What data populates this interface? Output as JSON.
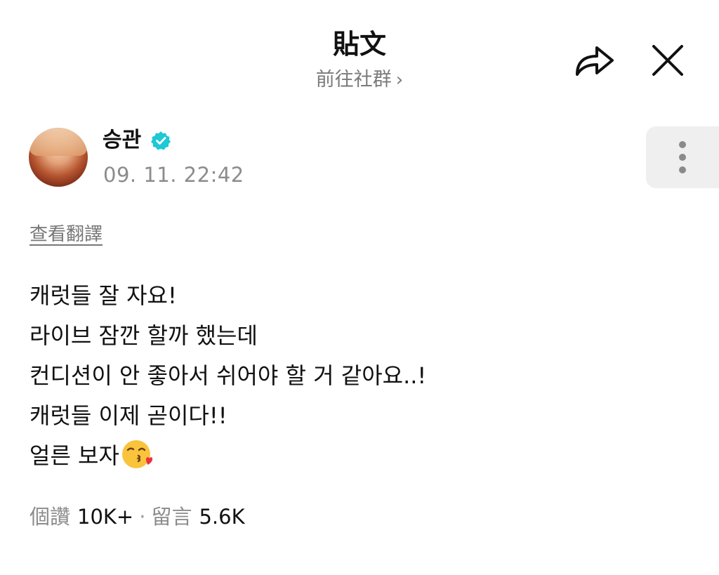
{
  "header": {
    "title": "貼文",
    "subtitle": "前往社群",
    "subtitle_chevron": "›"
  },
  "actions": {
    "share_icon": "share-arrow-icon",
    "close_icon": "close-icon",
    "more_icon": "more-vertical-icon"
  },
  "post": {
    "author": "승관",
    "verified": true,
    "verified_color": "#1ec8d6",
    "time": "09. 11. 22:42",
    "translate_label": "查看翻譯",
    "lines": [
      "캐럿들 잘 자요!",
      "라이브 잠깐 할까 했는데",
      "컨디션이 안 좋아서 쉬어야 할 거 같아요..!",
      "캐럿들 이제 곧이다!!",
      "얼른 보자"
    ],
    "trailing_emoji": "face-blowing-kiss"
  },
  "stats": {
    "likes_label": "個讚",
    "likes_value": "10K+",
    "separator": "·",
    "comments_label": "留言",
    "comments_value": "5.6K"
  }
}
